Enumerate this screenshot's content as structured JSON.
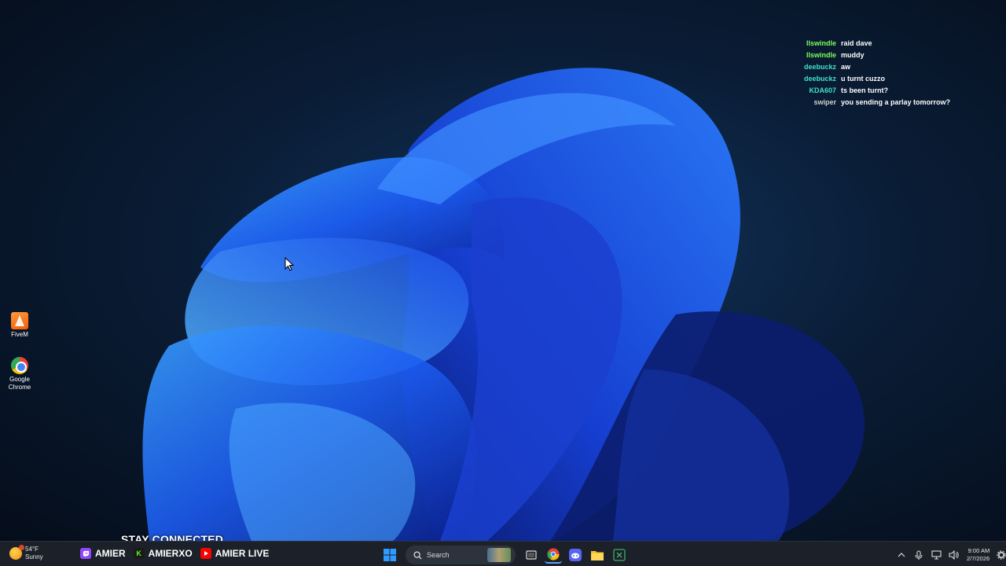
{
  "chat": {
    "messages": [
      {
        "user": "llswindle",
        "text": "raid dave",
        "color": "#7cff5a"
      },
      {
        "user": "llswindle",
        "text": "muddy",
        "color": "#7cff5a"
      },
      {
        "user": "deebuckz",
        "text": "aw",
        "color": "#3fe0c8"
      },
      {
        "user": "deebuckz",
        "text": "u turnt cuzzo",
        "color": "#3fe0c8"
      },
      {
        "user": "KDA607",
        "text": "ts been turnt?",
        "color": "#3fe0c8"
      },
      {
        "user": "swiper",
        "text": "you sending a parlay tomorrow?",
        "color": "#d0d0d0"
      }
    ]
  },
  "desktop": {
    "icons": [
      {
        "label": "FiveM",
        "icon": "fivem-icon"
      },
      {
        "label": "Google Chrome",
        "icon": "chrome-icon"
      }
    ]
  },
  "overlay": {
    "stay_connected": "STAY CONNECTED",
    "socials": [
      {
        "platform": "twitch",
        "label": "AMIER",
        "color": "#9146ff"
      },
      {
        "platform": "kick",
        "label": "AMIERXO",
        "color": "#53fc18"
      },
      {
        "platform": "youtube",
        "label": "AMIER LIVE",
        "color": "#ff0000"
      }
    ]
  },
  "taskbar": {
    "weather": {
      "temp": "54°F",
      "condition": "Sunny"
    },
    "search_placeholder": "Search",
    "clock": {
      "time": "9:00 AM",
      "date": "2/7/2026"
    }
  },
  "colors": {
    "taskbar_bg": "#1c2129",
    "accent": "#2f7bff"
  }
}
